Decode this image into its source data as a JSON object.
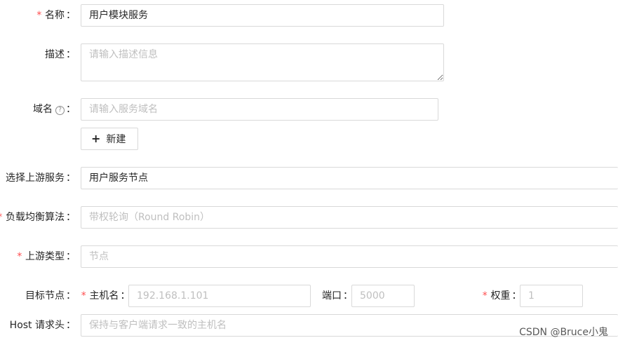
{
  "form": {
    "name": {
      "label": "名称",
      "required": "*",
      "value": "用户模块服务"
    },
    "description": {
      "label": "描述",
      "placeholder": "请输入描述信息"
    },
    "domain": {
      "label": "域名",
      "help_icon": "question-circle-icon",
      "help_glyph": "?",
      "placeholder": "请输入服务域名"
    },
    "new_button": {
      "label": "新建",
      "icon": "plus-icon",
      "glyph": "+"
    },
    "upstream": {
      "label": "选择上游服务",
      "value": "用户服务节点"
    },
    "algorithm": {
      "label": "负载均衡算法",
      "required": "*",
      "placeholder": "带权轮询（Round Robin）"
    },
    "upstream_type": {
      "label": "上游类型",
      "required": "*",
      "placeholder": "节点"
    },
    "target_node": {
      "label": "目标节点",
      "host": {
        "label": "主机名",
        "required": "*",
        "placeholder": "192.168.1.101"
      },
      "port": {
        "label": "端口",
        "placeholder": "5000"
      },
      "weight": {
        "label": "权重",
        "required": "*",
        "placeholder": "1"
      }
    },
    "host_header": {
      "label": "Host 请求头",
      "placeholder": "保持与客户端请求一致的主机名"
    }
  },
  "colon": "：",
  "watermark": "CSDN @Bruce小鬼"
}
